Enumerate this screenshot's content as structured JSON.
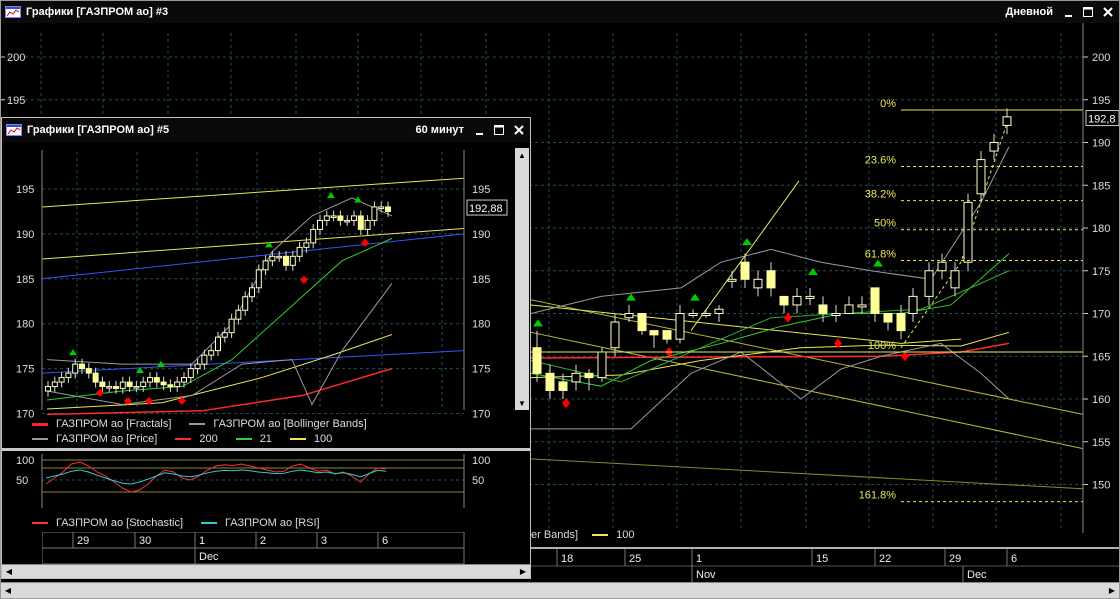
{
  "main_window": {
    "title": "Графики [ГАЗПРОМ ао] #3",
    "period": "Дневной",
    "price_ticks": [
      "200",
      "195",
      "190",
      "185",
      "180",
      "175",
      "170",
      "165",
      "160",
      "155",
      "150"
    ],
    "current_price": "192,8",
    "fib_levels": [
      {
        "label": "0%"
      },
      {
        "label": "23.6%"
      },
      {
        "label": "38.2%"
      },
      {
        "label": "50%"
      },
      {
        "label": "61.8%"
      },
      {
        "label": "100%"
      },
      {
        "label": "161.8%"
      }
    ],
    "legend_partial": "er Bands]",
    "legend_100": "100",
    "date_row1": [
      "18",
      "25",
      "1",
      "15",
      "22",
      "29",
      "6"
    ],
    "date_row2": [
      "Nov",
      "Dec"
    ]
  },
  "sub_window": {
    "title": "Графики [ГАЗПРОМ ао] #5",
    "period": "60 минут",
    "price_ticks": [
      "195",
      "190",
      "185",
      "180",
      "175",
      "170"
    ],
    "current_price": "192,88",
    "legend": {
      "fractals": "ГАЗПРОМ ао [Fractals]",
      "bollinger": "ГАЗПРОМ ао [Bollinger Bands]",
      "price": "ГАЗПРОМ ао [Price]",
      "ma200": "200",
      "ma21": "21",
      "ma100": "100"
    },
    "osc_ticks": [
      "100",
      "50"
    ],
    "osc_legend": {
      "stochastic": "ГАЗПРОМ ао [Stochastic]",
      "rsi": "ГАЗПРОМ ао [RSI]"
    },
    "date_row1": [
      "29",
      "30",
      "1",
      "2",
      "3",
      "6"
    ],
    "date_row2": [
      "Dec"
    ]
  },
  "colors": {
    "bg": "#000000",
    "grid": "#1f4a4a",
    "candle_up": "#ffff99",
    "candle_down": "#ffff99",
    "fractal_up": "#00cc00",
    "fractal_down": "#ff0000",
    "ma200": "#ff2a2a",
    "ma21": "#33cc33",
    "ma100": "#e8e85a",
    "bollinger": "#9a9a9a",
    "channel": "#e8e85a",
    "blue_line": "#3355ff",
    "stoch": "#ff3333",
    "rsi": "#33cccc"
  },
  "icons": [
    "chart-window-icon",
    "minimize-icon",
    "maximize-icon",
    "close-icon",
    "scroll-left-icon",
    "scroll-right-icon",
    "scroll-up-icon",
    "scroll-down-icon"
  ]
}
